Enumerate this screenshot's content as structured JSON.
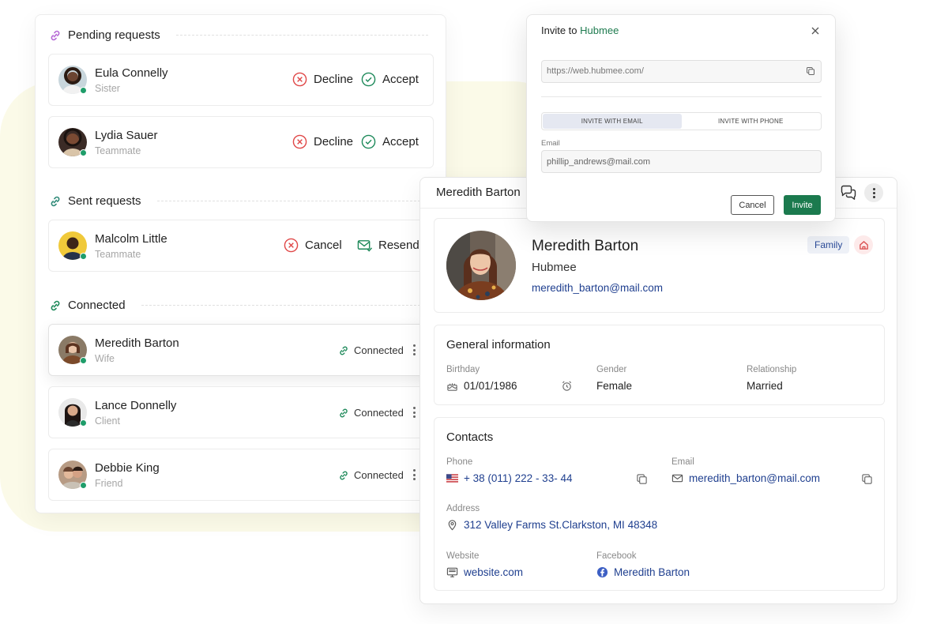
{
  "pending": {
    "title": "Pending requests",
    "rows": [
      {
        "name": "Eula Connelly",
        "role": "Sister",
        "decline": "Decline",
        "accept": "Accept"
      },
      {
        "name": "Lydia Sauer",
        "role": "Teammate",
        "decline": "Decline",
        "accept": "Accept"
      }
    ]
  },
  "sent": {
    "title": "Sent requests",
    "rows": [
      {
        "name": "Malcolm Little",
        "role": "Teammate",
        "cancel": "Cancel",
        "resend": "Resend"
      }
    ]
  },
  "connected": {
    "title": "Connected",
    "status_label": "Connected",
    "rows": [
      {
        "name": "Meredith Barton",
        "role": "Wife"
      },
      {
        "name": "Lance Donnelly",
        "role": "Client"
      },
      {
        "name": "Debbie King",
        "role": "Friend"
      }
    ]
  },
  "profile": {
    "header_title": "Meredith Barton",
    "name": "Meredith Barton",
    "company": "Hubmee",
    "email": "meredith_barton@mail.com",
    "badge": "Family",
    "general": {
      "title": "General information",
      "birthday_label": "Birthday",
      "birthday": "01/01/1986",
      "gender_label": "Gender",
      "gender": "Female",
      "relationship_label": "Relationship",
      "relationship": "Married"
    },
    "contacts": {
      "title": "Contacts",
      "phone_label": "Phone",
      "phone": "+ 38 (011) 222 - 33- 44",
      "email_label": "Email",
      "email": "meredith_barton@mail.com",
      "address_label": "Address",
      "address": "312 Valley Farms St.Clarkston, MI 48348",
      "website_label": "Website",
      "website": "website.com",
      "facebook_label": "Facebook",
      "facebook": "Meredith Barton"
    }
  },
  "invite": {
    "title_prefix": "Invite to",
    "brand": "Hubmee",
    "url": "https://web.hubmee.com/",
    "tab_email": "INVITE WITH EMAIL",
    "tab_phone": "INVITE WITH PHONE",
    "email_label": "Email",
    "email_value": "phillip_andrews@mail.com",
    "cancel": "Cancel",
    "submit": "Invite"
  },
  "colors": {
    "accent_green": "#1b7a4e",
    "link_blue": "#1f3f8f",
    "decline_red": "#e04848",
    "online_green": "#1f9d6a",
    "pending_link_purple": "#b66bd6"
  }
}
